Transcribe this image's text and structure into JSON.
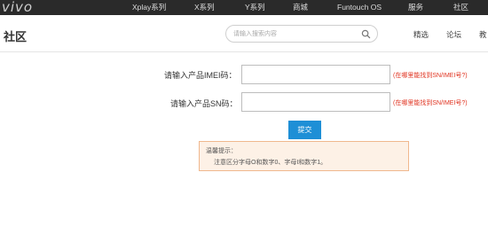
{
  "header": {
    "logo": "vivo",
    "nav": [
      "Xplay系列",
      "X系列",
      "Y系列",
      "商城",
      "Funtouch OS",
      "服务",
      "社区"
    ]
  },
  "subheader": {
    "title": "社区",
    "search_placeholder": "请输入搜索内容",
    "links": [
      "精选",
      "论坛",
      "教"
    ]
  },
  "form": {
    "imei_label": "请输入产品IMEI码：",
    "imei_help": "(在哪里能找到SN/IMEI号?)",
    "sn_label": "请输入产品SN码：",
    "sn_help": "(在哪里能找到SN/IMEI号?)",
    "submit_label": "提交"
  },
  "tip": {
    "title": "温馨提示：",
    "text": "注意区分字母O和数字0、字母I和数字1。"
  },
  "colors": {
    "topbar": "#2a2a2a",
    "accent": "#1e8fd6",
    "help_link": "#e0321f",
    "tip_bg": "#fdf1e6",
    "tip_border": "#f0b88e"
  }
}
